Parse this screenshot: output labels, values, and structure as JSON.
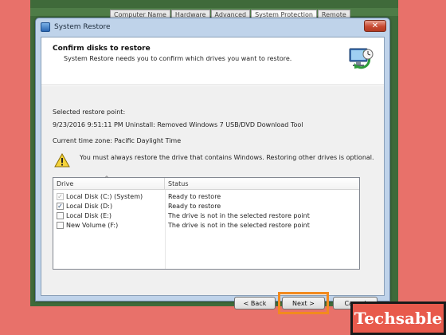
{
  "background_tabs": [
    "Computer Name",
    "Hardware",
    "Advanced",
    "System Protection",
    "Remote"
  ],
  "window": {
    "title": "System Restore",
    "close_symbol": "✕"
  },
  "header": {
    "title": "Confirm disks to restore",
    "subtitle": "System Restore needs you to confirm which drives you want to restore."
  },
  "restore_point": {
    "label": "Selected restore point:",
    "value": "9/23/2016 9:51:11 PM Uninstall: Removed Windows 7 USB/DVD Download Tool"
  },
  "timezone": "Current time zone: Pacific Daylight Time",
  "warning": "You must always restore the drive that contains Windows. Restoring other drives is optional.",
  "table": {
    "columns": [
      "Drive",
      "Status"
    ],
    "rows": [
      {
        "drive": "Local Disk (C:) (System)",
        "status": "Ready to restore",
        "checked": true,
        "disabled": true
      },
      {
        "drive": "Local Disk (D:)",
        "status": "Ready to restore",
        "checked": true,
        "disabled": false
      },
      {
        "drive": "Local Disk (E:)",
        "status": "The drive is not in the selected restore point",
        "checked": false,
        "disabled": false
      },
      {
        "drive": "New Volume (F:)",
        "status": "The drive is not in the selected restore point",
        "checked": false,
        "disabled": false
      }
    ]
  },
  "buttons": {
    "back": "< Back",
    "next": "Next >",
    "cancel": "Cancel"
  },
  "brand": "Techsable",
  "colors": {
    "highlight": "#f28a1e",
    "background": "#e8716a",
    "brand_bg": "#e85a4c"
  },
  "icons": [
    "window-icon",
    "close-icon",
    "system-restore-icon",
    "warning-icon",
    "sort-arrow-icon",
    "checkbox-icon"
  ]
}
